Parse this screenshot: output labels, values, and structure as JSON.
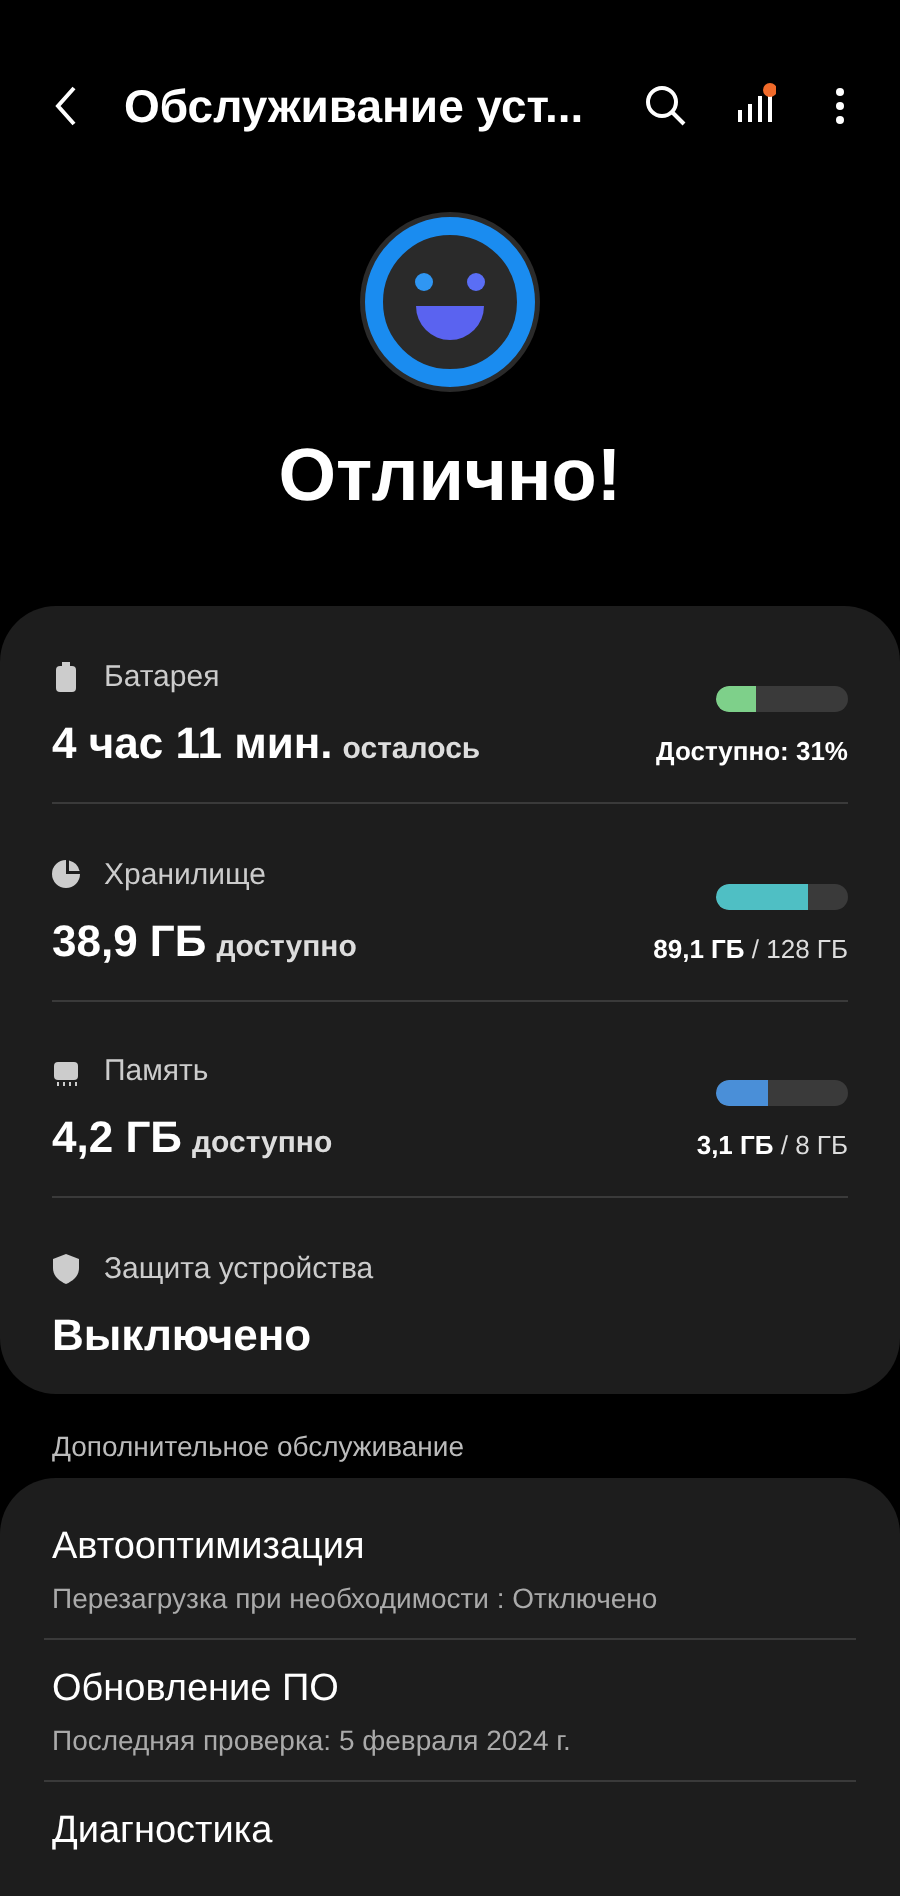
{
  "header": {
    "title": "Обслуживание уст...",
    "stats_badge": true
  },
  "status": {
    "text": "Отлично!"
  },
  "items": [
    {
      "kind": "battery",
      "label": "Батарея",
      "value": "4 час 11 мин.",
      "suffix": "осталось",
      "level": 0.31,
      "color": "#7ed08a",
      "reading": "**Доступно: 31%**"
    },
    {
      "kind": "storage",
      "label": "Хранилище",
      "value": "38,9 ГБ",
      "suffix": "доступно",
      "level": 0.7,
      "color": "#4fbfc4",
      "reading": "**89,1 ГБ** / 128 ГБ"
    },
    {
      "kind": "memory",
      "label": "Память",
      "value": "4,2 ГБ",
      "suffix": "доступно",
      "level": 0.39,
      "color": "#4a8fd8",
      "reading": "**3,1 ГБ** / 8 ГБ"
    },
    {
      "kind": "protection",
      "label": "Защита устройства",
      "value": "Выключено"
    }
  ],
  "extra": {
    "heading": "Дополнительное обслуживание",
    "items": [
      {
        "title": "Автооптимизация",
        "subtitle": "Перезагрузка при необходимости : Отключено"
      },
      {
        "title": "Обновление ПО",
        "subtitle": "Последняя проверка: 5 февраля 2024 г."
      },
      {
        "title": "Диагностика"
      }
    ]
  }
}
